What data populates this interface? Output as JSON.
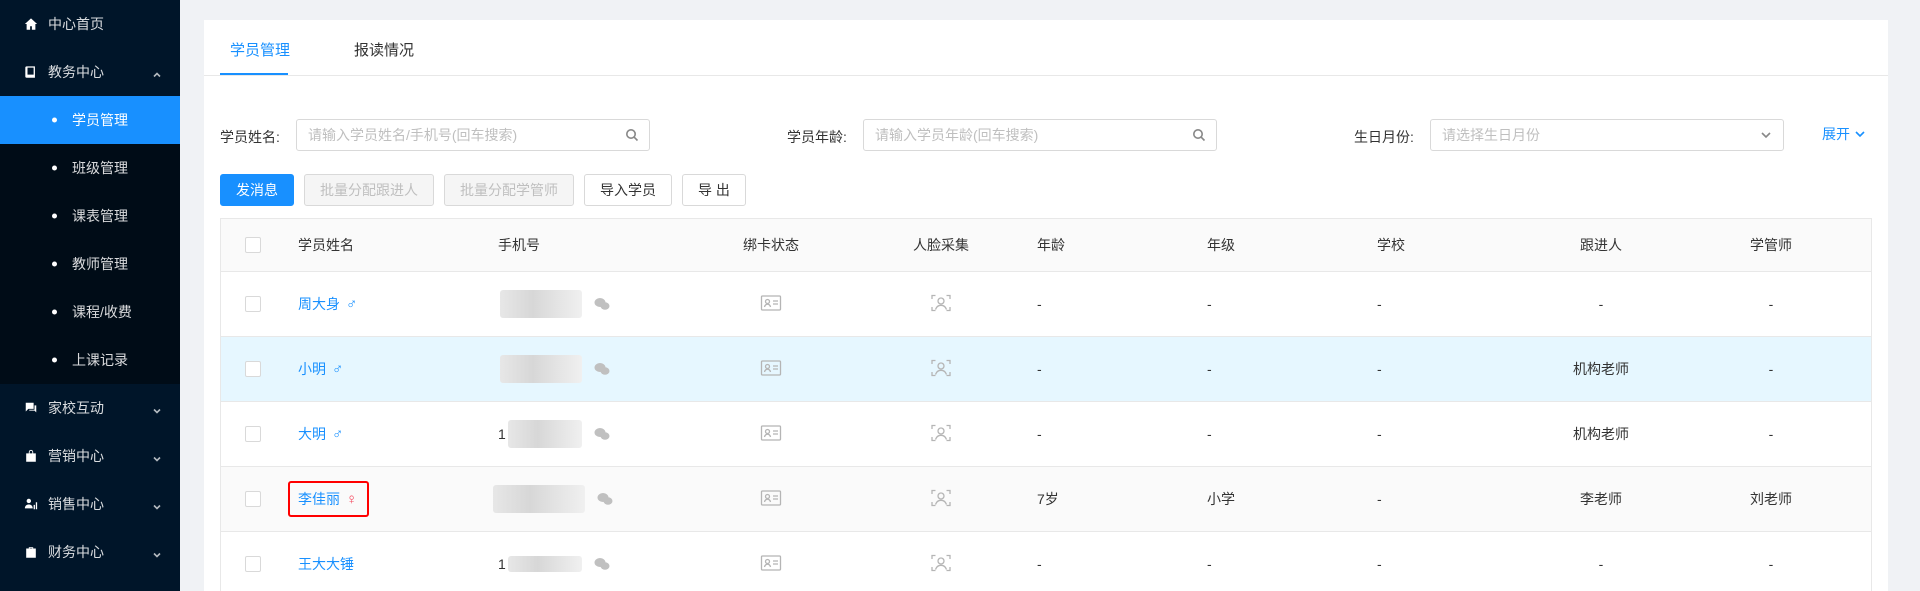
{
  "sidebar": {
    "items": [
      {
        "label": "中心首页",
        "icon": "home-icon"
      },
      {
        "label": "教务中心",
        "icon": "book-icon",
        "expanded": true,
        "children": [
          "学员管理",
          "班级管理",
          "课表管理",
          "教师管理",
          "课程/收费",
          "上课记录"
        ]
      },
      {
        "label": "家校互动",
        "icon": "chat-icon"
      },
      {
        "label": "营销中心",
        "icon": "bag-icon"
      },
      {
        "label": "销售中心",
        "icon": "user-chart-icon"
      },
      {
        "label": "财务中心",
        "icon": "wallet-icon"
      }
    ],
    "active_child": "学员管理"
  },
  "tabs": [
    "学员管理",
    "报读情况"
  ],
  "filters": {
    "name_label": "学员姓名:",
    "name_placeholder": "请输入学员姓名/手机号(回车搜索)",
    "age_label": "学员年龄:",
    "age_placeholder": "请输入学员年龄(回车搜索)",
    "birth_label": "生日月份:",
    "birth_placeholder": "请选择生日月份",
    "expand_label": "展开"
  },
  "toolbar": {
    "send_msg": "发消息",
    "assign_follower": "批量分配跟进人",
    "assign_manager": "批量分配学管师",
    "import": "导入学员",
    "export": "导 出"
  },
  "table": {
    "columns": [
      "学员姓名",
      "手机号",
      "绑卡状态",
      "人脸采集",
      "年龄",
      "年级",
      "学校",
      "跟进人",
      "学管师"
    ],
    "rows": [
      {
        "name": "周大身",
        "gender": "♂",
        "phone_prefix": "",
        "age": "-",
        "grade": "-",
        "school": "-",
        "follower": "-",
        "manager": "-"
      },
      {
        "name": "小明",
        "gender": "♂",
        "phone_prefix": "",
        "age": "-",
        "grade": "-",
        "school": "-",
        "follower": "机构老师",
        "manager": "-"
      },
      {
        "name": "大明",
        "gender": "♂",
        "phone_prefix": "1",
        "age": "-",
        "grade": "-",
        "school": "-",
        "follower": "机构老师",
        "manager": "-"
      },
      {
        "name": "李佳丽",
        "gender": "♀",
        "phone_prefix": "",
        "age": "7岁",
        "grade": "小学",
        "school": "-",
        "follower": "李老师",
        "manager": "刘老师"
      },
      {
        "name": "王大大锤",
        "gender": "",
        "phone_prefix": "1",
        "age": "-",
        "grade": "-",
        "school": "-",
        "follower": "-",
        "manager": "-"
      }
    ]
  },
  "colors": {
    "accent": "#1890ff",
    "sidebar_bg": "#001529",
    "highlight_row": "#e6f7ff",
    "female": "#f5455c"
  }
}
